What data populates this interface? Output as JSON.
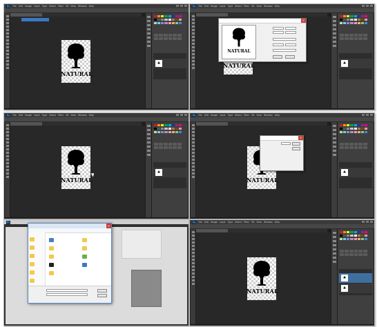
{
  "app": {
    "logo": "Ps",
    "menu": [
      "File",
      "Edit",
      "Image",
      "Layer",
      "Type",
      "Select",
      "Filter",
      "3D",
      "View",
      "Window",
      "Help"
    ]
  },
  "artwork": {
    "wordmark": "NATURAL"
  },
  "panels": {
    "tabs_top": "Color  Swatches",
    "tabs_mid": "Adjustments  Styles",
    "tabs_layers": "Layers  Channels  Paths"
  },
  "colors": {
    "ui_dark": "#282828",
    "ui_panel": "#3f3f3f",
    "selection_blue": "#3b78c4",
    "dialog_bg": "#f0f0f0",
    "win_close": "#c94236"
  },
  "swatch_colors": [
    "#e3131b",
    "#f7941d",
    "#fff200",
    "#00a651",
    "#00aeef",
    "#2e3192",
    "#92278f",
    "#ec008c",
    "#000000",
    "#555555",
    "#8c8c8c",
    "#c7c7c7",
    "#ffffff",
    "#a67c52",
    "#7d4900",
    "#f5989d",
    "#c4df9b",
    "#6dcff6",
    "#8393ca",
    "#bd8cbf",
    "#f49ac1",
    "#fbaf5d",
    "#82ca9c",
    "#448ccb"
  ],
  "icons": [
    "tree-icon",
    "close-icon",
    "folder-icon",
    "cursor-icon"
  ]
}
